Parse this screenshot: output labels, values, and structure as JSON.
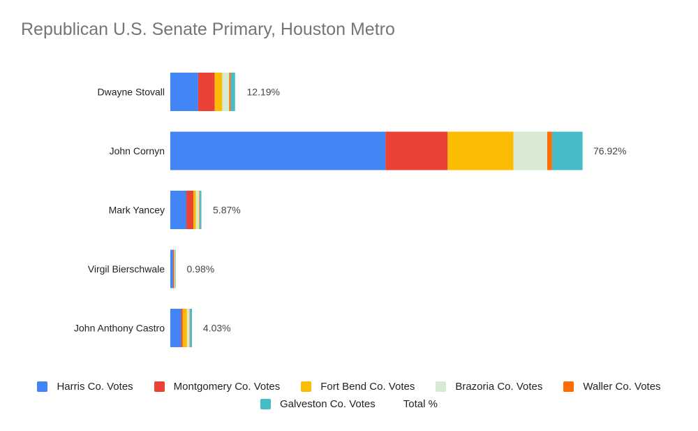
{
  "chart_data": {
    "type": "bar",
    "orientation": "horizontal",
    "stacked": true,
    "title": "Republican U.S. Senate Primary, Houston Metro",
    "xlabel": "",
    "ylabel": "",
    "grid": false,
    "legend_position": "bottom",
    "xlim": [
      0,
      80
    ],
    "categories": [
      "Dwayne Stovall",
      "John Cornyn",
      "Mark Yancey",
      "Virgil Bierschwale",
      "John Anthony Castro"
    ],
    "series": [
      {
        "name": "Harris Co. Votes",
        "color": "#4285f4",
        "values": [
          5.2,
          40.2,
          3.0,
          0.5,
          2.0
        ]
      },
      {
        "name": "Montgomery Co. Votes",
        "color": "#ea4335",
        "values": [
          3.1,
          11.6,
          1.3,
          0.15,
          0.3
        ]
      },
      {
        "name": "Fort Bend Co. Votes",
        "color": "#fbbc04",
        "values": [
          1.4,
          12.3,
          0.5,
          0.1,
          0.8
        ]
      },
      {
        "name": "Brazoria Co.  Votes",
        "color": "#d9ead3",
        "values": [
          1.3,
          6.3,
          0.6,
          0.1,
          0.5
        ]
      },
      {
        "name": "Waller Co.  Votes",
        "color": "#ff6d01",
        "values": [
          0.3,
          0.9,
          0.1,
          0.03,
          0.1
        ]
      },
      {
        "name": "Galveston Co. Votes",
        "color": "#46bdc6",
        "values": [
          0.8,
          5.7,
          0.3,
          0.1,
          0.35
        ]
      }
    ],
    "total_series": {
      "name": "Total %",
      "labels": [
        "12.19%",
        "76.92%",
        "5.87%",
        "0.98%",
        "4.03%"
      ],
      "values": [
        12.19,
        76.92,
        5.87,
        0.98,
        4.03
      ]
    }
  }
}
